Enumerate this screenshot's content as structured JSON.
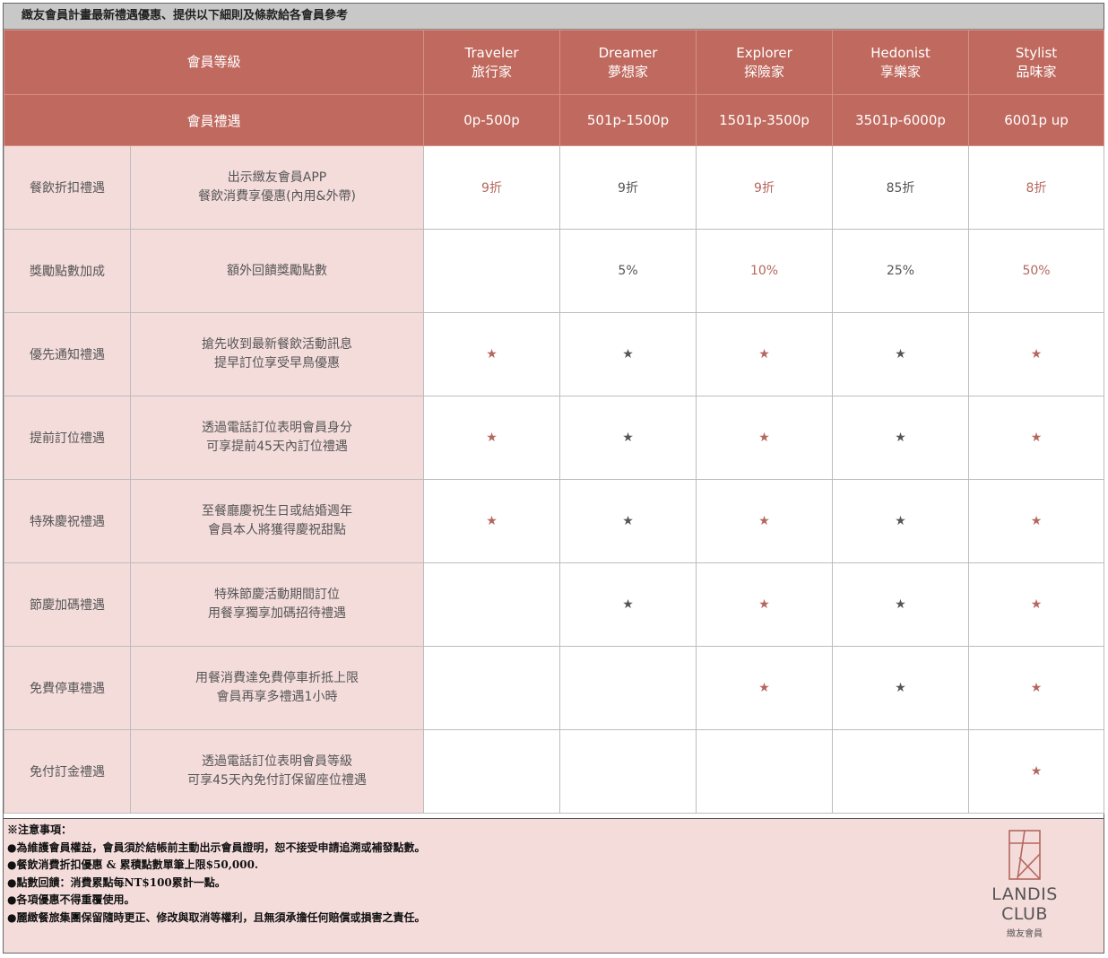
{
  "title": "緻友會員計畫最新禮遇優惠、提供以下細則及條款給各會員參考",
  "header": {
    "level_label": "會員等級",
    "benefit_label": "會員禮遇",
    "tiers": [
      {
        "en": "Traveler",
        "zh": "旅行家",
        "points": "0p-500p"
      },
      {
        "en": "Dreamer",
        "zh": "夢想家",
        "points": "501p-1500p"
      },
      {
        "en": "Explorer",
        "zh": "探險家",
        "points": "1501p-3500p"
      },
      {
        "en": "Hedonist",
        "zh": "享樂家",
        "points": "3501p-6000p"
      },
      {
        "en": "Stylist",
        "zh": "品味家",
        "points": "6001p up"
      }
    ]
  },
  "rows": [
    {
      "name": "餐飲折扣禮遇",
      "desc1": "出示緻友會員APP",
      "desc2": "餐飲消費享優惠(內用&外帶)",
      "values": [
        "9折",
        "9折",
        "9折",
        "85折",
        "8折"
      ],
      "tones": [
        "red",
        "grey",
        "red",
        "grey",
        "red"
      ]
    },
    {
      "name": "獎勵點數加成",
      "desc1": "額外回饋獎勵點數",
      "desc2": "",
      "values": [
        "",
        "5%",
        "10%",
        "25%",
        "50%"
      ],
      "tones": [
        "red",
        "grey",
        "red",
        "grey",
        "red"
      ]
    },
    {
      "name": "優先通知禮遇",
      "desc1": "搶先收到最新餐飲活動訊息",
      "desc2": "提早訂位享受早鳥優惠",
      "values": [
        "★",
        "★",
        "★",
        "★",
        "★"
      ],
      "tones": [
        "red",
        "grey",
        "red",
        "grey",
        "red"
      ]
    },
    {
      "name": "提前訂位禮遇",
      "desc1": "透過電話訂位表明會員身分",
      "desc2": "可享提前45天內訂位禮遇",
      "values": [
        "★",
        "★",
        "★",
        "★",
        "★"
      ],
      "tones": [
        "red",
        "grey",
        "red",
        "grey",
        "red"
      ]
    },
    {
      "name": "特殊慶祝禮遇",
      "desc1": "至餐廳慶祝生日或結婚週年",
      "desc2": "會員本人將獲得慶祝甜點",
      "values": [
        "★",
        "★",
        "★",
        "★",
        "★"
      ],
      "tones": [
        "red",
        "grey",
        "red",
        "grey",
        "red"
      ]
    },
    {
      "name": "節慶加碼禮遇",
      "desc1": "特殊節慶活動期間訂位",
      "desc2": "用餐享獨享加碼招待禮遇",
      "values": [
        "",
        "★",
        "★",
        "★",
        "★"
      ],
      "tones": [
        "red",
        "grey",
        "red",
        "grey",
        "red"
      ]
    },
    {
      "name": "免費停車禮遇",
      "desc1": "用餐消費達免費停車折抵上限",
      "desc2": "會員再享多禮遇1小時",
      "values": [
        "",
        "",
        "★",
        "★",
        "★"
      ],
      "tones": [
        "red",
        "grey",
        "red",
        "grey",
        "red"
      ]
    },
    {
      "name": "免付訂金禮遇",
      "desc1": "透過電話訂位表明會員等級",
      "desc2": "可享45天內免付訂保留座位禮遇",
      "values": [
        "",
        "",
        "",
        "",
        "★"
      ],
      "tones": [
        "red",
        "grey",
        "red",
        "grey",
        "red"
      ]
    }
  ],
  "notes": {
    "heading": "※注意事項：",
    "items": [
      "●為維護會員權益，會員須於結帳前主動出示會員證明，恕不接受申請追溯或補發點數。",
      "●餐飲消費折扣優惠 & 累積點數單筆上限$50,000.",
      "●點數回饋：消費累點每NT$100累計一點。",
      "●各項優惠不得重覆使用。",
      "●麗緻餐旅集團保留隨時更正、修改與取消等權利，且無須承擔任何賠償或損害之責任。"
    ]
  },
  "logo": {
    "brand": "LANDIS CLUB",
    "sub": "緻友會員",
    "icon": "landis-club-logo-icon"
  },
  "colors": {
    "header_bg": "#c0695e",
    "label_bg": "#f4dcdb",
    "accent": "#b4675e",
    "title_bar": "#c8c8c8"
  }
}
